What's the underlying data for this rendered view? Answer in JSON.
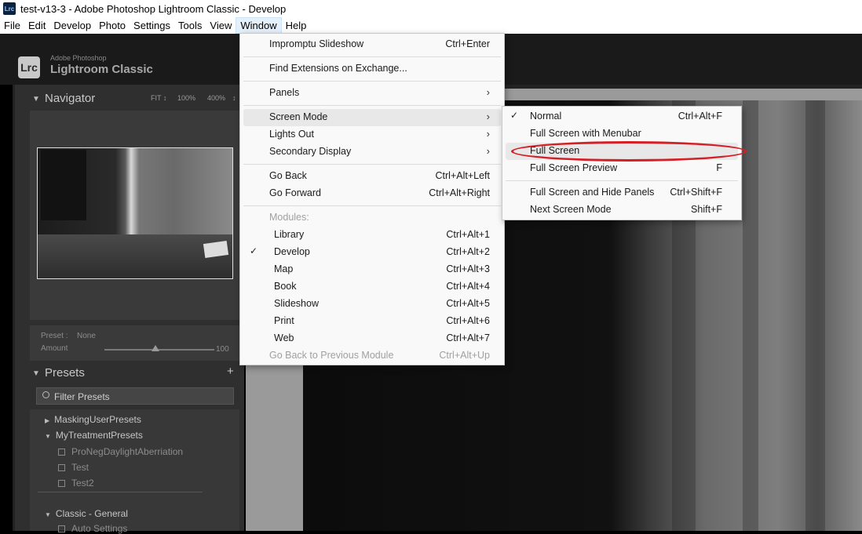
{
  "window": {
    "title": "test-v13-3 - Adobe Photoshop Lightroom Classic - Develop",
    "icon": "Lrc"
  },
  "menubar": [
    "File",
    "Edit",
    "Develop",
    "Photo",
    "Settings",
    "Tools",
    "View",
    "Window",
    "Help"
  ],
  "brand": {
    "badge": "Lrc",
    "small": "Adobe Photoshop",
    "big": "Lightroom Classic"
  },
  "navigator": {
    "title": "Navigator",
    "zoom": [
      "FIT ↕",
      "100%",
      "400%",
      "↕"
    ]
  },
  "preset_box": {
    "preset_label": "Preset :",
    "preset_value": "None",
    "amount_label": "Amount",
    "amount_value": "100",
    "amount_level": 100
  },
  "presets": {
    "title": "Presets",
    "add": "+",
    "filter_placeholder": "Filter Presets",
    "items": [
      {
        "label": "MaskingUserPresets",
        "type": "folder",
        "open": false
      },
      {
        "label": "MyTreatmentPresets",
        "type": "folder",
        "open": true
      },
      {
        "label": "ProNegDaylightAberriation",
        "type": "preset"
      },
      {
        "label": "Test",
        "type": "preset"
      },
      {
        "label": "Test2",
        "type": "preset"
      },
      {
        "label": "Classic - General",
        "type": "folder",
        "open": true
      },
      {
        "label": "Auto Settings",
        "type": "preset"
      }
    ]
  },
  "window_menu": {
    "items": [
      {
        "label": "Impromptu Slideshow",
        "shortcut": "Ctrl+Enter"
      },
      {
        "label": "Find Extensions on Exchange..."
      },
      {
        "label": "Panels",
        "submenu": true
      },
      {
        "label": "Screen Mode",
        "submenu": true,
        "highlighted": true
      },
      {
        "label": "Lights Out",
        "submenu": true
      },
      {
        "label": "Secondary Display",
        "submenu": true
      },
      {
        "label": "Go Back",
        "shortcut": "Ctrl+Alt+Left"
      },
      {
        "label": "Go Forward",
        "shortcut": "Ctrl+Alt+Right"
      },
      {
        "label": "Modules:",
        "disabled": true
      },
      {
        "label": "Library",
        "shortcut": "Ctrl+Alt+1"
      },
      {
        "label": "Develop",
        "shortcut": "Ctrl+Alt+2",
        "checked": true
      },
      {
        "label": "Map",
        "shortcut": "Ctrl+Alt+3"
      },
      {
        "label": "Book",
        "shortcut": "Ctrl+Alt+4"
      },
      {
        "label": "Slideshow",
        "shortcut": "Ctrl+Alt+5"
      },
      {
        "label": "Print",
        "shortcut": "Ctrl+Alt+6"
      },
      {
        "label": "Web",
        "shortcut": "Ctrl+Alt+7"
      },
      {
        "label": "Go Back to Previous Module",
        "shortcut": "Ctrl+Alt+Up",
        "disabled": true
      }
    ]
  },
  "screen_mode_menu": {
    "items": [
      {
        "label": "Normal",
        "shortcut": "Ctrl+Alt+F",
        "checked": true
      },
      {
        "label": "Full Screen with Menubar",
        "shortcut": ""
      },
      {
        "label": "Full Screen",
        "shortcut": "",
        "highlighted": true,
        "circled": true
      },
      {
        "label": "Full Screen Preview",
        "shortcut": "F"
      },
      {
        "label": "Full Screen and Hide Panels",
        "shortcut": "Ctrl+Shift+F"
      },
      {
        "label": "Next Screen Mode",
        "shortcut": "Shift+F"
      }
    ]
  },
  "colors": {
    "annotation_red": "#d51f26",
    "menu_bg": "#f9f9f9",
    "panel_bg": "#2f2f2f"
  }
}
